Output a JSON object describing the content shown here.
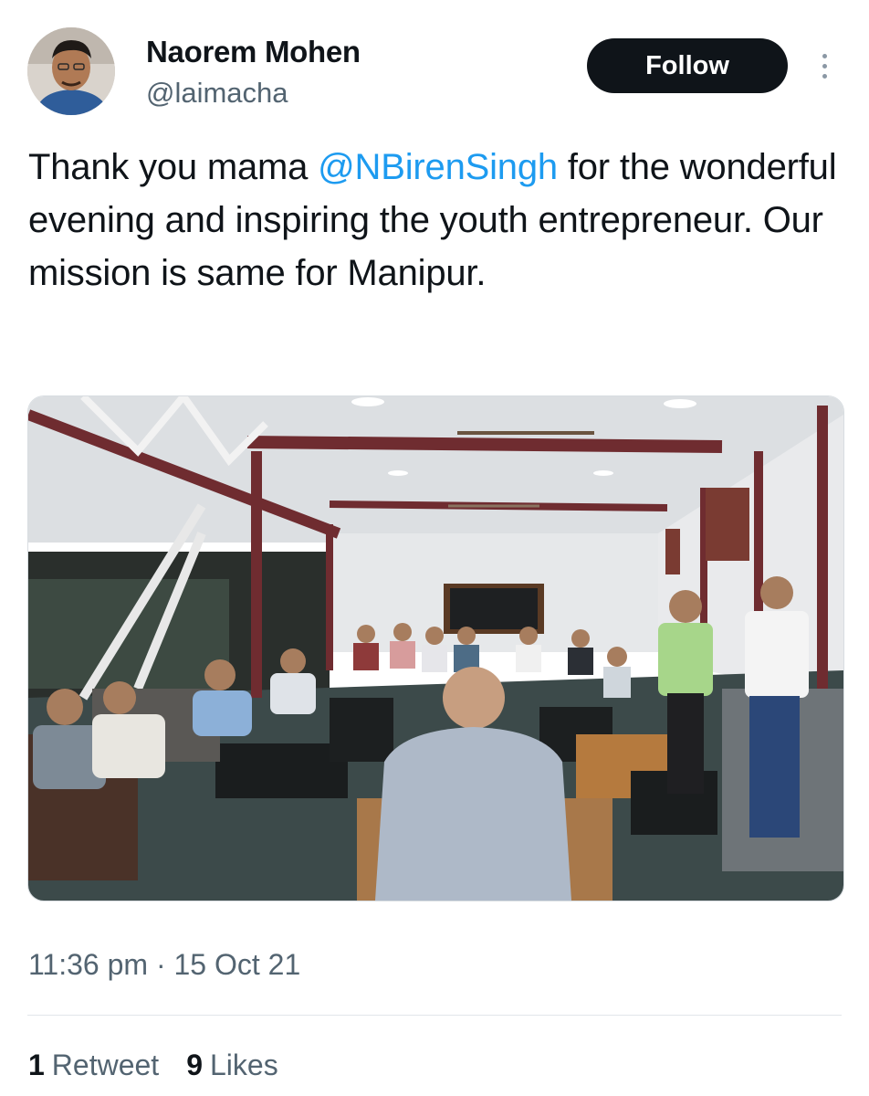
{
  "author": {
    "display_name": "Naorem Mohen",
    "handle": "@laimacha"
  },
  "actions": {
    "follow_label": "Follow"
  },
  "tweet": {
    "text_before": "Thank you mama ",
    "mention": "@NBirenSingh",
    "text_after": " for the wonderful evening and inspiring the youth entrepreneur. Our mission is same for Manipur.",
    "timestamp": "11:36 pm · 15 Oct 21"
  },
  "stats": {
    "retweets_count": "1",
    "retweets_label": "Retweet",
    "likes_count": "9",
    "likes_label": "Likes"
  },
  "colors": {
    "mention": "#1d9bf0",
    "follow_button": "#0f1419",
    "secondary_text": "#536471"
  }
}
